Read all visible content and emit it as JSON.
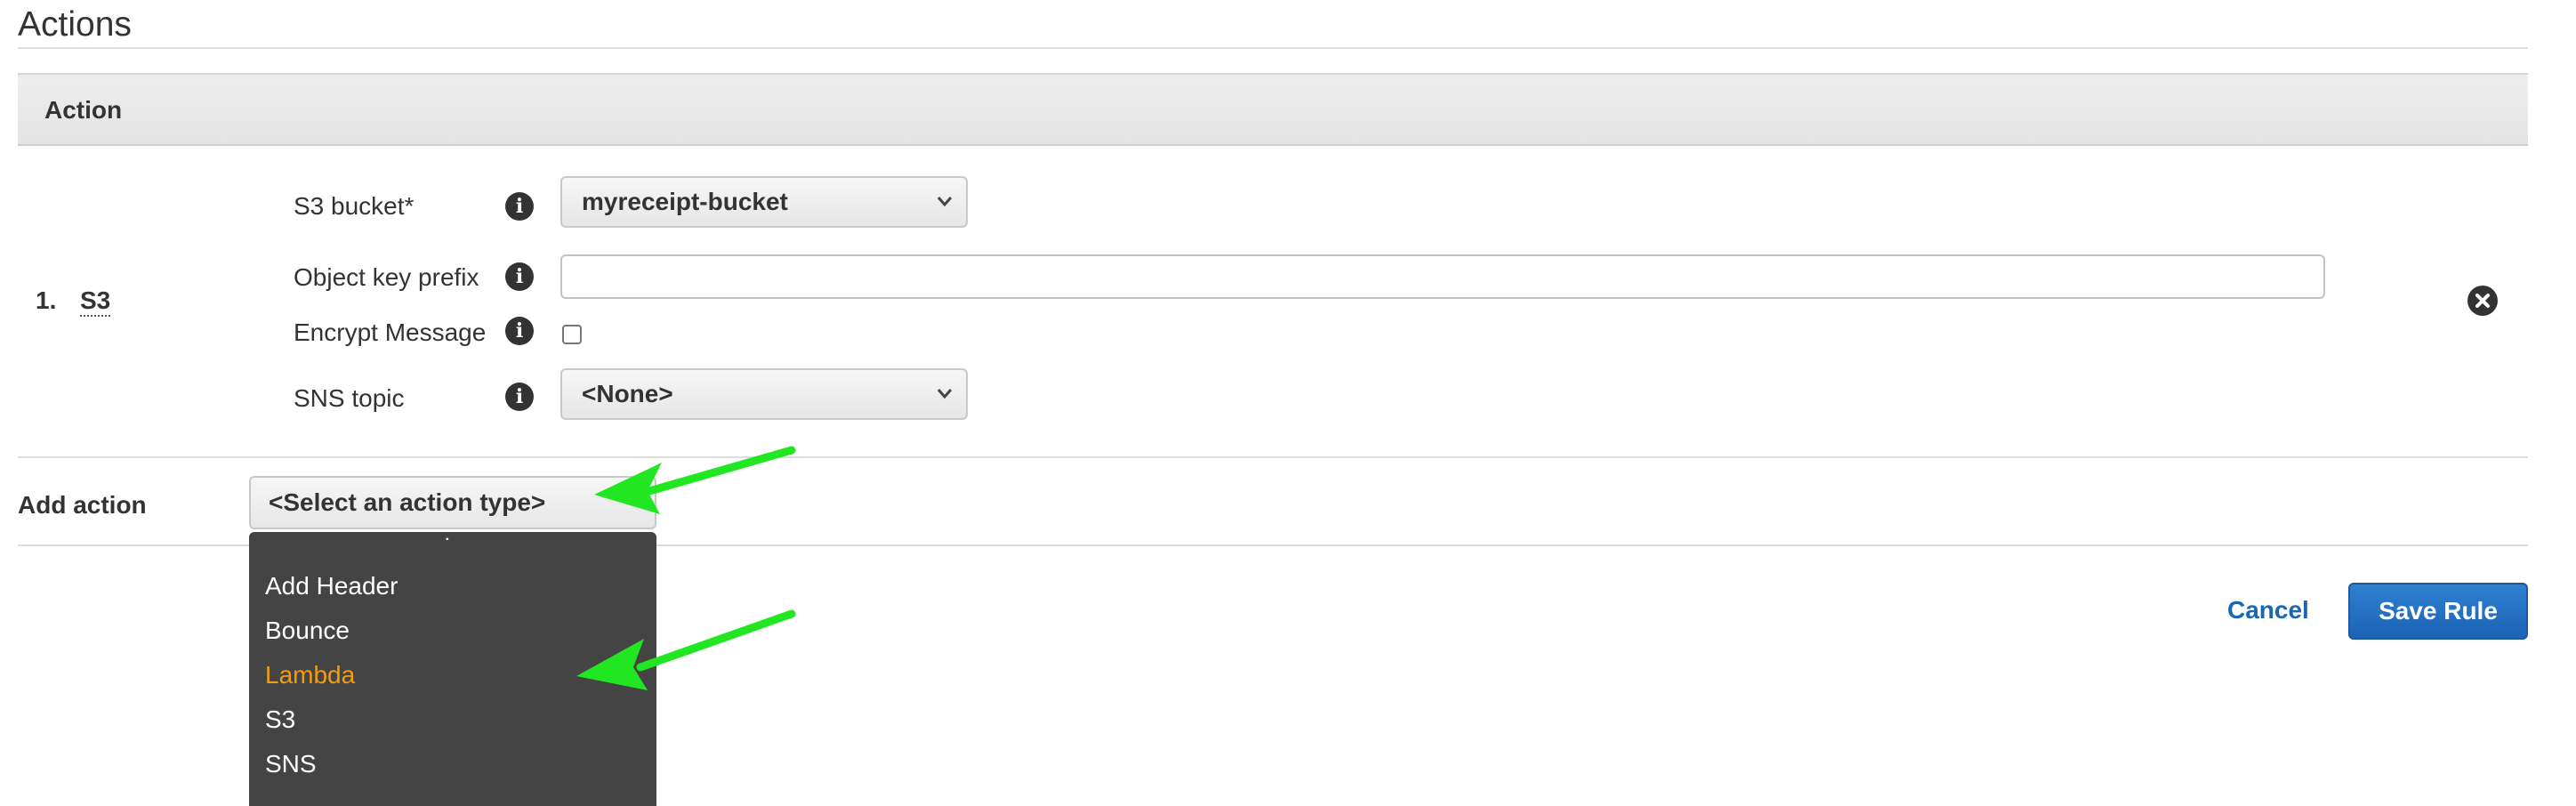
{
  "section": {
    "title": "Actions"
  },
  "table": {
    "header": "Action"
  },
  "action_row": {
    "number": "1.",
    "type": "S3",
    "fields": {
      "s3_bucket_label": "S3 bucket*",
      "s3_bucket_value": "myreceipt-bucket",
      "object_key_prefix_label": "Object key prefix",
      "object_key_prefix_value": "",
      "encrypt_message_label": "Encrypt Message",
      "encrypt_message_checked": false,
      "sns_topic_label": "SNS topic",
      "sns_topic_value": "<None>"
    },
    "info_icon_glyph": "i"
  },
  "add_action": {
    "label": "Add action",
    "select_value": "<Select an action type>",
    "options": [
      {
        "label": "Add Header",
        "highlighted": false
      },
      {
        "label": "Bounce",
        "highlighted": false
      },
      {
        "label": "Lambda",
        "highlighted": true
      },
      {
        "label": "S3",
        "highlighted": false
      },
      {
        "label": "SNS",
        "highlighted": false
      }
    ]
  },
  "footer": {
    "cancel_label": "Cancel",
    "save_label": "Save Rule"
  },
  "colors": {
    "accent_blue": "#1a66b4",
    "highlight_orange": "#f39c12",
    "annotation_arrow": "#22e622",
    "dropdown_bg": "#444444"
  },
  "icons": {
    "info": "info-icon",
    "remove": "close-circle-icon",
    "chevron": "chevron-down-icon",
    "annotation": "arrow-annotation"
  }
}
